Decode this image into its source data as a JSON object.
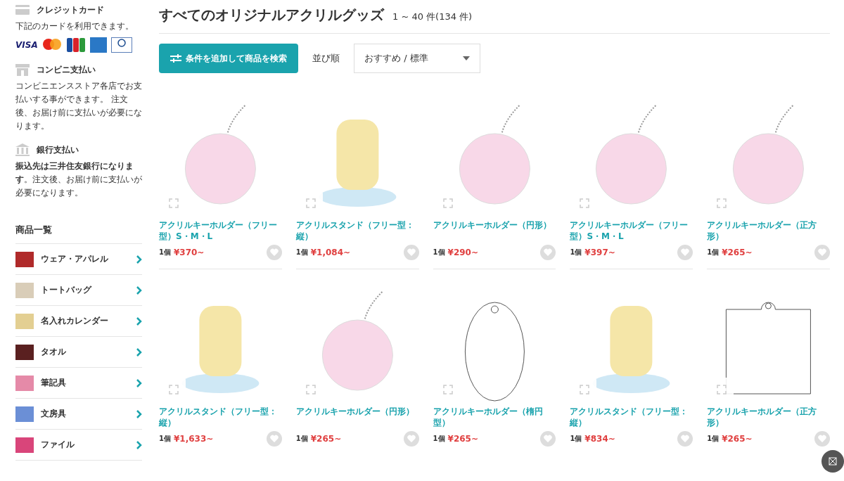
{
  "sidebar": {
    "payments": [
      {
        "kind": "card",
        "title": "クレジットカード",
        "text": "下記のカードを利用できます。",
        "cards": [
          {
            "kind": "visa",
            "label": "VISA"
          },
          {
            "kind": "mastercard"
          },
          {
            "kind": "jcb"
          },
          {
            "kind": "amex"
          },
          {
            "kind": "diners"
          }
        ]
      },
      {
        "kind": "store",
        "title": "コンビニ支払い",
        "text": "コンビニエンスストア各店でお支払いする事ができます。 注文後、お届け前に支払いが必要になります。"
      },
      {
        "kind": "bank",
        "title": "銀行支払い",
        "text": "**振込先は三井住友銀行になります**。注文後、お届け前に支払いが必要になります。"
      }
    ],
    "categories_title": "商品一覧",
    "categories": [
      {
        "label": "ウェア・アパレル",
        "color": "#b02a2a"
      },
      {
        "label": "トートバッグ",
        "color": "#d9cdb8"
      },
      {
        "label": "名入れカレンダー",
        "color": "#e3cf92"
      },
      {
        "label": "タオル",
        "color": "#5a2020"
      },
      {
        "label": "筆記具",
        "color": "#e58aa8"
      },
      {
        "label": "文房具",
        "color": "#6b8fd6"
      },
      {
        "label": "ファイル",
        "color": "#d9457a"
      }
    ]
  },
  "main": {
    "title": "すべてのオリジナルアクリルグッズ",
    "count": "1 ~ 40 件(134 件)",
    "search_button": "条件を追加して商品を検索",
    "sort_label": "並び順",
    "sort_value": "おすすめ / 標準",
    "products": [
      {
        "name": "アクリルキーホルダー（フリー型）S・M・L",
        "qty": "1個",
        "price": "¥370~",
        "kind": "chain"
      },
      {
        "name": "アクリルスタンド（フリー型：縦）",
        "qty": "1個",
        "price": "¥1,084~",
        "kind": "stand"
      },
      {
        "name": "アクリルキーホルダー（円形）",
        "qty": "1個",
        "price": "¥290~",
        "kind": "chain"
      },
      {
        "name": "アクリルキーホルダー（フリー型）S・M・L",
        "qty": "1個",
        "price": "¥397~",
        "kind": "chain"
      },
      {
        "name": "アクリルキーホルダー（正方形）",
        "qty": "1個",
        "price": "¥265~",
        "kind": "chain"
      },
      {
        "name": "アクリルスタンド（フリー型：縦）",
        "qty": "1個",
        "price": "¥1,633~",
        "kind": "stand"
      },
      {
        "name": "アクリルキーホルダー（円形）",
        "qty": "1個",
        "price": "¥265~",
        "kind": "chain"
      },
      {
        "name": "アクリルキーホルダー（楕円型）",
        "qty": "1個",
        "price": "¥265~",
        "kind": "oval"
      },
      {
        "name": "アクリルスタンド（フリー型：縦）",
        "qty": "1個",
        "price": "¥834~",
        "kind": "stand"
      },
      {
        "name": "アクリルキーホルダー（正方形）",
        "qty": "1個",
        "price": "¥265~",
        "kind": "square"
      }
    ]
  }
}
